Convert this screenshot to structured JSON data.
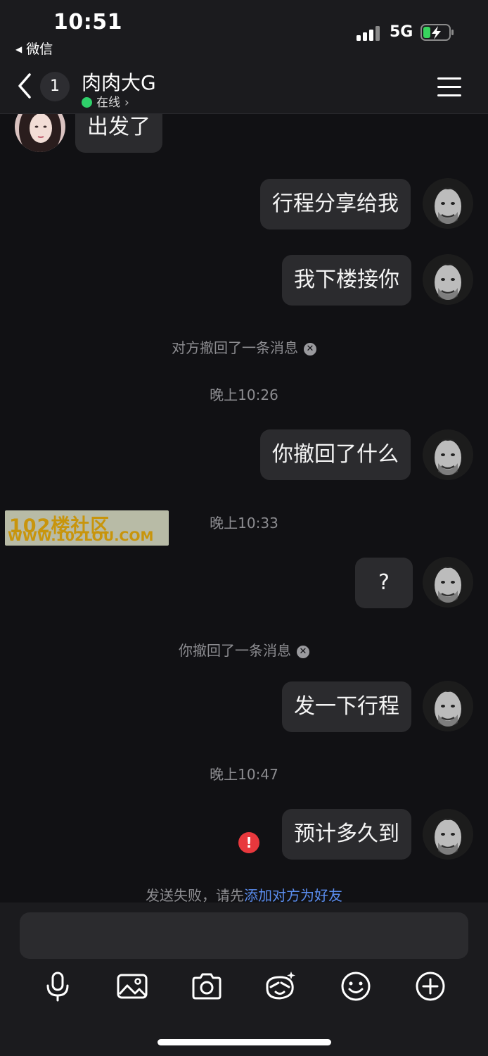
{
  "status_bar": {
    "time": "10:51",
    "back_app": "微信",
    "network": "5G",
    "battery_charging": true
  },
  "header": {
    "unread_count": "1",
    "contact_name": "肉肉大G",
    "status": "在线"
  },
  "messages": {
    "m1": "出发了",
    "m2": "行程分享给我",
    "m3": "我下楼接你",
    "sys1": "对方撤回了一条消息",
    "time1": "晚上10:26",
    "m4": "你撤回了什么",
    "time2": "晚上10:33",
    "m5": "?",
    "sys2": "你撤回了一条消息",
    "m6": "发一下行程",
    "time3": "晚上10:47",
    "m7": "预计多久到",
    "fail_prefix": "发送失败，请先",
    "fail_link": "添加对方为好友"
  },
  "watermark": {
    "line1": "102楼社区",
    "line2": "WWW.102LOU.COM"
  },
  "toolbar": [
    "microphone-icon",
    "image-icon",
    "camera-icon",
    "sticker-icon",
    "emoji-icon",
    "plus-icon"
  ],
  "colors": {
    "background": "#111114",
    "bar": "#1b1b1e",
    "bubble": "#2b2b2e",
    "online": "#2fd06a",
    "link": "#5b8ef0",
    "error": "#e8383d"
  }
}
